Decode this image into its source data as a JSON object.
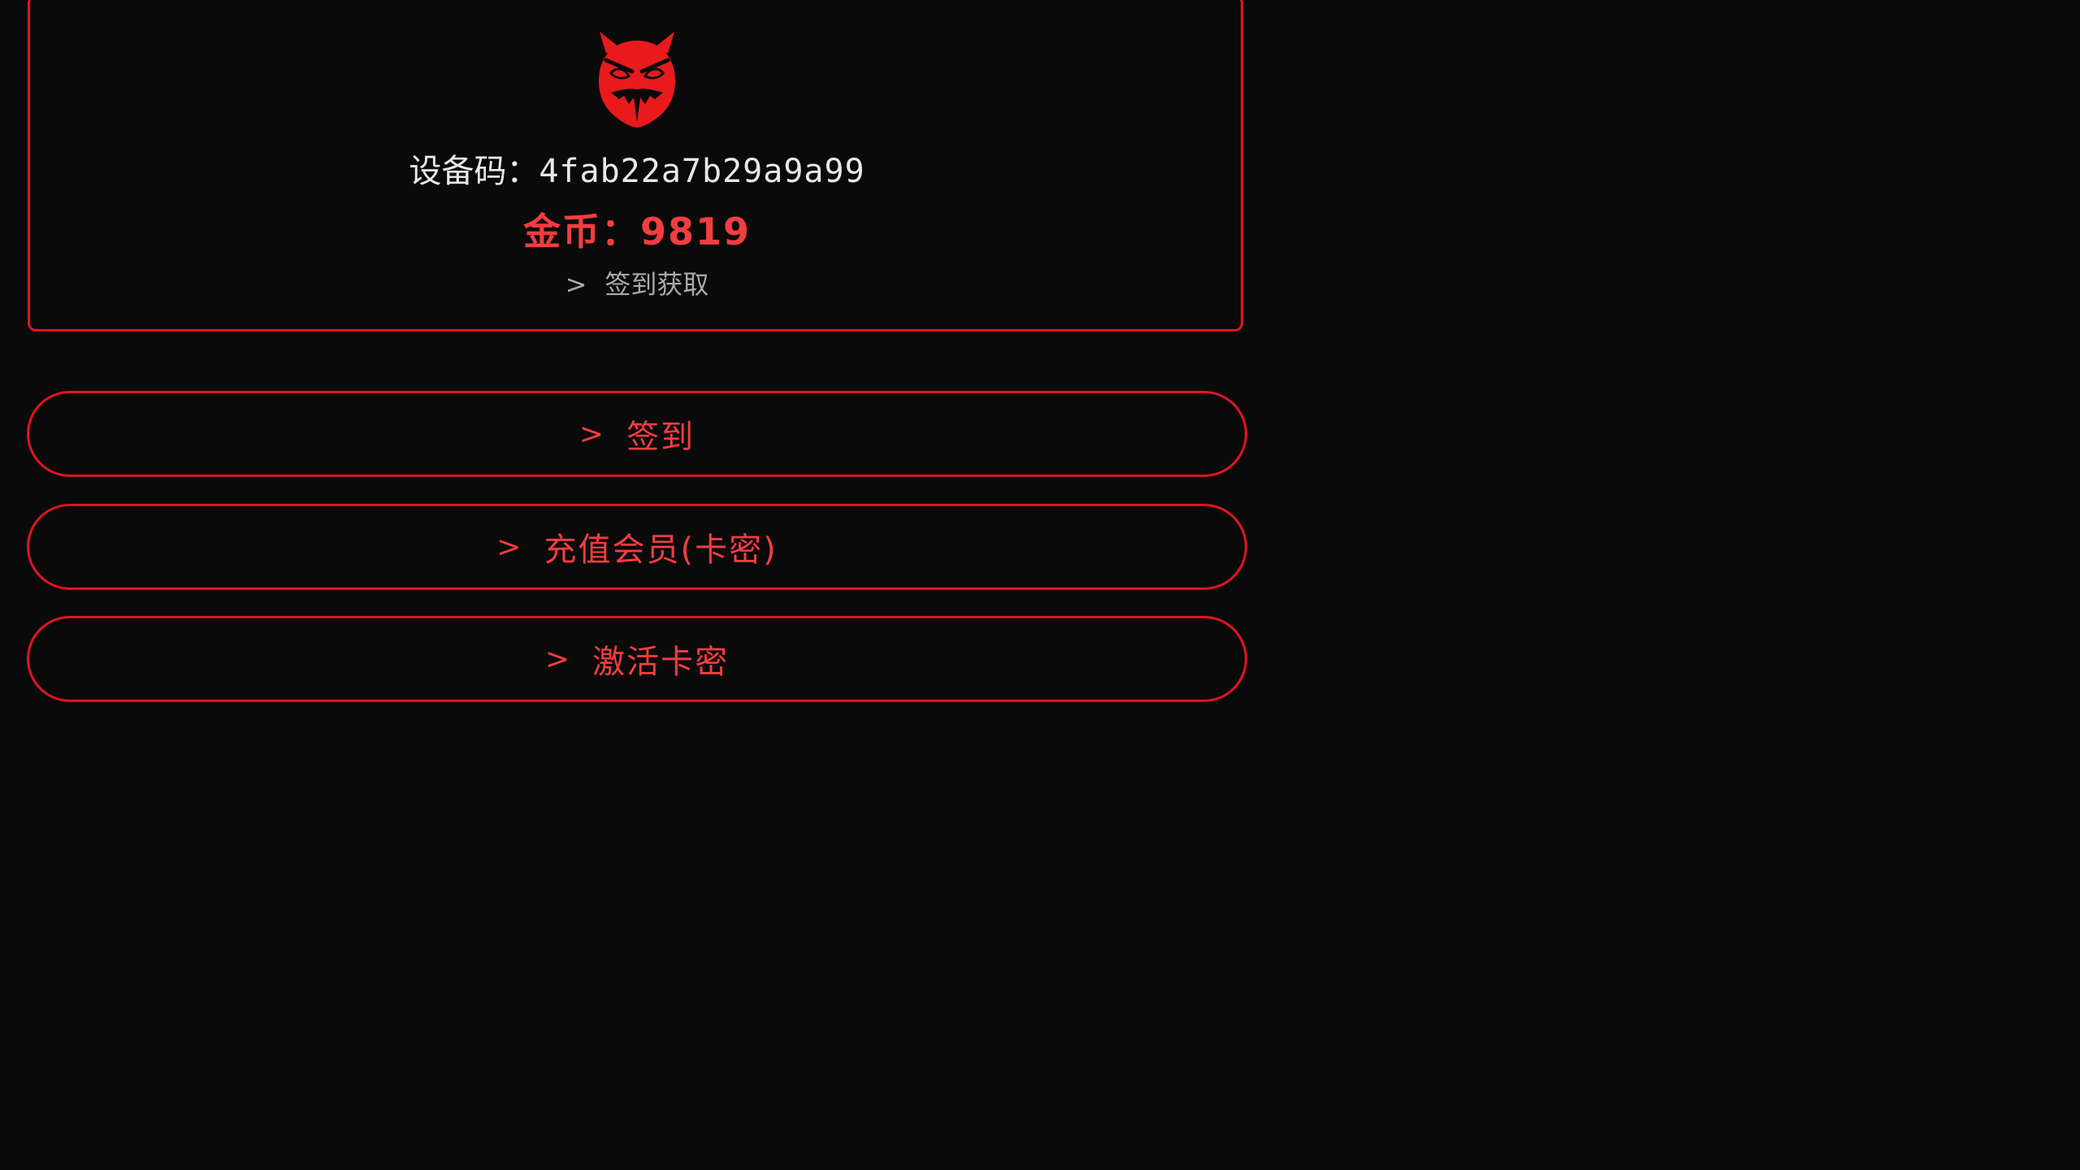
{
  "profile": {
    "device_label": "设备码：",
    "device_code": "4fab22a7b29a9a99",
    "coins_label": "金币：",
    "coins_value": "9819",
    "hint_arrow": ">",
    "hint_text": "签到获取"
  },
  "actions": [
    {
      "arrow": ">",
      "label": "签到"
    },
    {
      "arrow": ">",
      "label": "充值会员(卡密)"
    },
    {
      "arrow": ">",
      "label": "激活卡密"
    }
  ],
  "colors": {
    "background": "#0a0a0b",
    "accent_red": "#e01420",
    "text_red": "#f43d40",
    "device_text": "#e9e9e9",
    "hint_text": "#a9a9a9"
  },
  "icons": {
    "mascot": "red-demon-owl-icon"
  }
}
